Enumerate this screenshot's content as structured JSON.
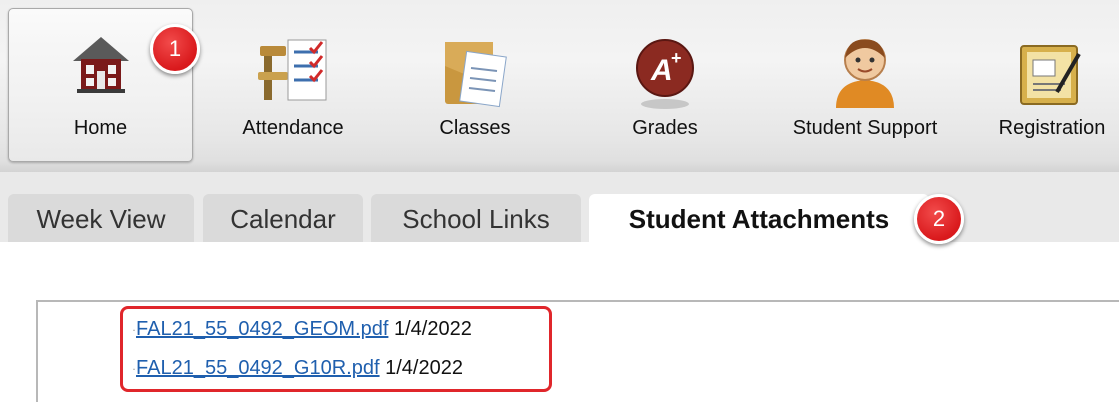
{
  "nav": {
    "items": [
      {
        "label": "Home",
        "icon": "school-house-icon",
        "active": true
      },
      {
        "label": "Attendance",
        "icon": "attendance-checklist-icon",
        "active": false
      },
      {
        "label": "Classes",
        "icon": "classes-folder-icon",
        "active": false
      },
      {
        "label": "Grades",
        "icon": "grades-a-plus-icon",
        "active": false
      },
      {
        "label": "Student Support",
        "icon": "student-person-icon",
        "active": false
      },
      {
        "label": "Registration",
        "icon": "registration-clipboard-icon",
        "active": false
      }
    ]
  },
  "callouts": [
    "1",
    "2"
  ],
  "subtabs": [
    {
      "label": "Week View",
      "active": false
    },
    {
      "label": "Calendar",
      "active": false
    },
    {
      "label": "School Links",
      "active": false
    },
    {
      "label": "Student Attachments",
      "active": true
    }
  ],
  "attachments": [
    {
      "file": "FAL21_55_0492_GEOM.pdf",
      "date": "1/4/2022"
    },
    {
      "file": "FAL21_55_0492_G10R.pdf",
      "date": "1/4/2022"
    }
  ],
  "colors": {
    "link": "#1f5fae",
    "callout": "#d9191c",
    "highlight_border": "#e0262b"
  }
}
